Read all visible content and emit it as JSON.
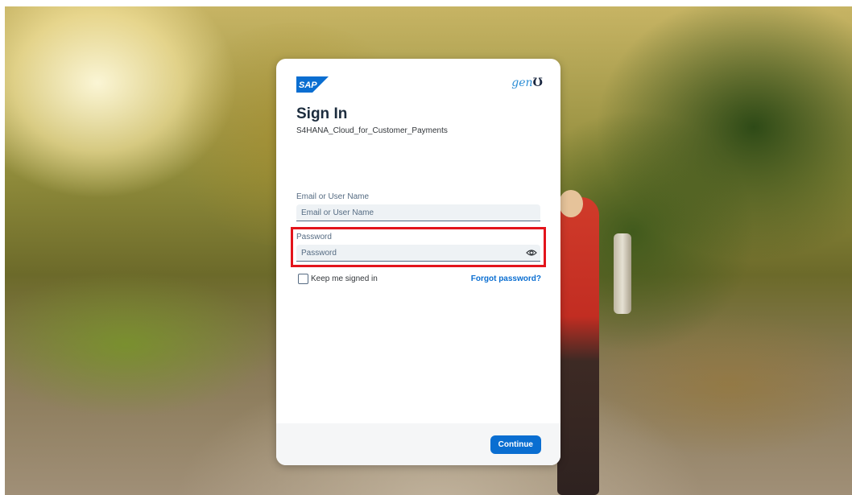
{
  "header": {
    "sap_logo_text": "SAP",
    "partner_logo_text": "gen",
    "title": "Sign In",
    "subtitle": "S4HANA_Cloud_for_Customer_Payments"
  },
  "form": {
    "username": {
      "label": "Email or User Name",
      "placeholder": "Email or User Name",
      "value": ""
    },
    "password": {
      "label": "Password",
      "placeholder": "Password",
      "value": "",
      "toggle_icon": "eye-icon"
    },
    "keep_signed_in": {
      "label": "Keep me signed in",
      "checked": false
    },
    "forgot_password_label": "Forgot password?"
  },
  "footer": {
    "continue_label": "Continue"
  },
  "colors": {
    "accent": "#0a6ed1",
    "highlight": "#e3141b",
    "title": "#1d2d3e"
  }
}
